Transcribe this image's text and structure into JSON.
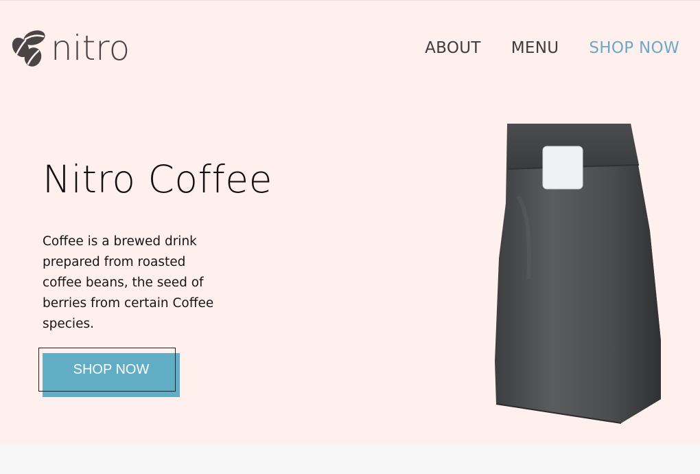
{
  "brand": {
    "name": "nitro",
    "icon": "coffee-beans-icon"
  },
  "nav": {
    "items": [
      {
        "label": "ABOUT"
      },
      {
        "label": "MENU"
      },
      {
        "label": "SHOP NOW"
      }
    ]
  },
  "hero": {
    "title": "Nitro Coffee",
    "description": "Coffee is a brewed drink prepared from roasted coffee beans, the seed of berries from certain Coffee species.",
    "cta_label": "SHOP NOW",
    "image": "coffee-bag-image"
  },
  "colors": {
    "hero_background": "#ffefed",
    "accent": "#61adc6",
    "nav_accent": "#6aaac6",
    "footer_band": "#f7f7f7"
  }
}
